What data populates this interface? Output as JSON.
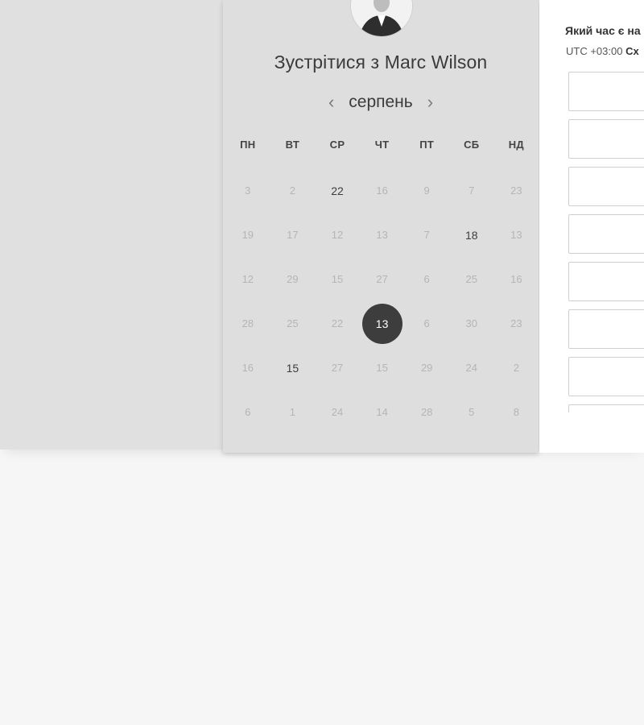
{
  "host": {
    "meet_prefix": "Зустрітися з",
    "name": "Marc Wilson"
  },
  "calendar": {
    "month": "серпень",
    "prev_icon": "chevron-left-icon",
    "next_icon": "chevron-right-icon",
    "weekdays": [
      "ПН",
      "ВТ",
      "СР",
      "ЧТ",
      "ПТ",
      "СБ",
      "НД"
    ],
    "weeks": [
      [
        {
          "d": "3",
          "s": "off"
        },
        {
          "d": "2",
          "s": "off"
        },
        {
          "d": "22",
          "s": "avail"
        },
        {
          "d": "16",
          "s": "off"
        },
        {
          "d": "9",
          "s": "off"
        },
        {
          "d": "7",
          "s": "off"
        },
        {
          "d": "23",
          "s": "off"
        }
      ],
      [
        {
          "d": "19",
          "s": "off"
        },
        {
          "d": "17",
          "s": "off"
        },
        {
          "d": "12",
          "s": "off"
        },
        {
          "d": "13",
          "s": "off"
        },
        {
          "d": "7",
          "s": "off"
        },
        {
          "d": "18",
          "s": "avail"
        },
        {
          "d": "13",
          "s": "off"
        }
      ],
      [
        {
          "d": "12",
          "s": "off"
        },
        {
          "d": "29",
          "s": "off"
        },
        {
          "d": "15",
          "s": "off"
        },
        {
          "d": "27",
          "s": "off"
        },
        {
          "d": "6",
          "s": "off"
        },
        {
          "d": "25",
          "s": "off"
        },
        {
          "d": "16",
          "s": "off"
        }
      ],
      [
        {
          "d": "28",
          "s": "off"
        },
        {
          "d": "25",
          "s": "off"
        },
        {
          "d": "22",
          "s": "off"
        },
        {
          "d": "13",
          "s": "selected"
        },
        {
          "d": "6",
          "s": "off"
        },
        {
          "d": "30",
          "s": "off"
        },
        {
          "d": "23",
          "s": "off"
        }
      ],
      [
        {
          "d": "16",
          "s": "off"
        },
        {
          "d": "15",
          "s": "avail"
        },
        {
          "d": "27",
          "s": "off"
        },
        {
          "d": "15",
          "s": "off"
        },
        {
          "d": "29",
          "s": "off"
        },
        {
          "d": "24",
          "s": "off"
        },
        {
          "d": "2",
          "s": "off"
        }
      ],
      [
        {
          "d": "6",
          "s": "off"
        },
        {
          "d": "1",
          "s": "off"
        },
        {
          "d": "24",
          "s": "off"
        },
        {
          "d": "14",
          "s": "off"
        },
        {
          "d": "28",
          "s": "off"
        },
        {
          "d": "5",
          "s": "off"
        },
        {
          "d": "8",
          "s": "off"
        }
      ]
    ]
  },
  "time_panel": {
    "question": "Який час є на",
    "timezone_prefix": "UTC +03:00",
    "timezone_name": "Сх",
    "slot_count": 8
  }
}
